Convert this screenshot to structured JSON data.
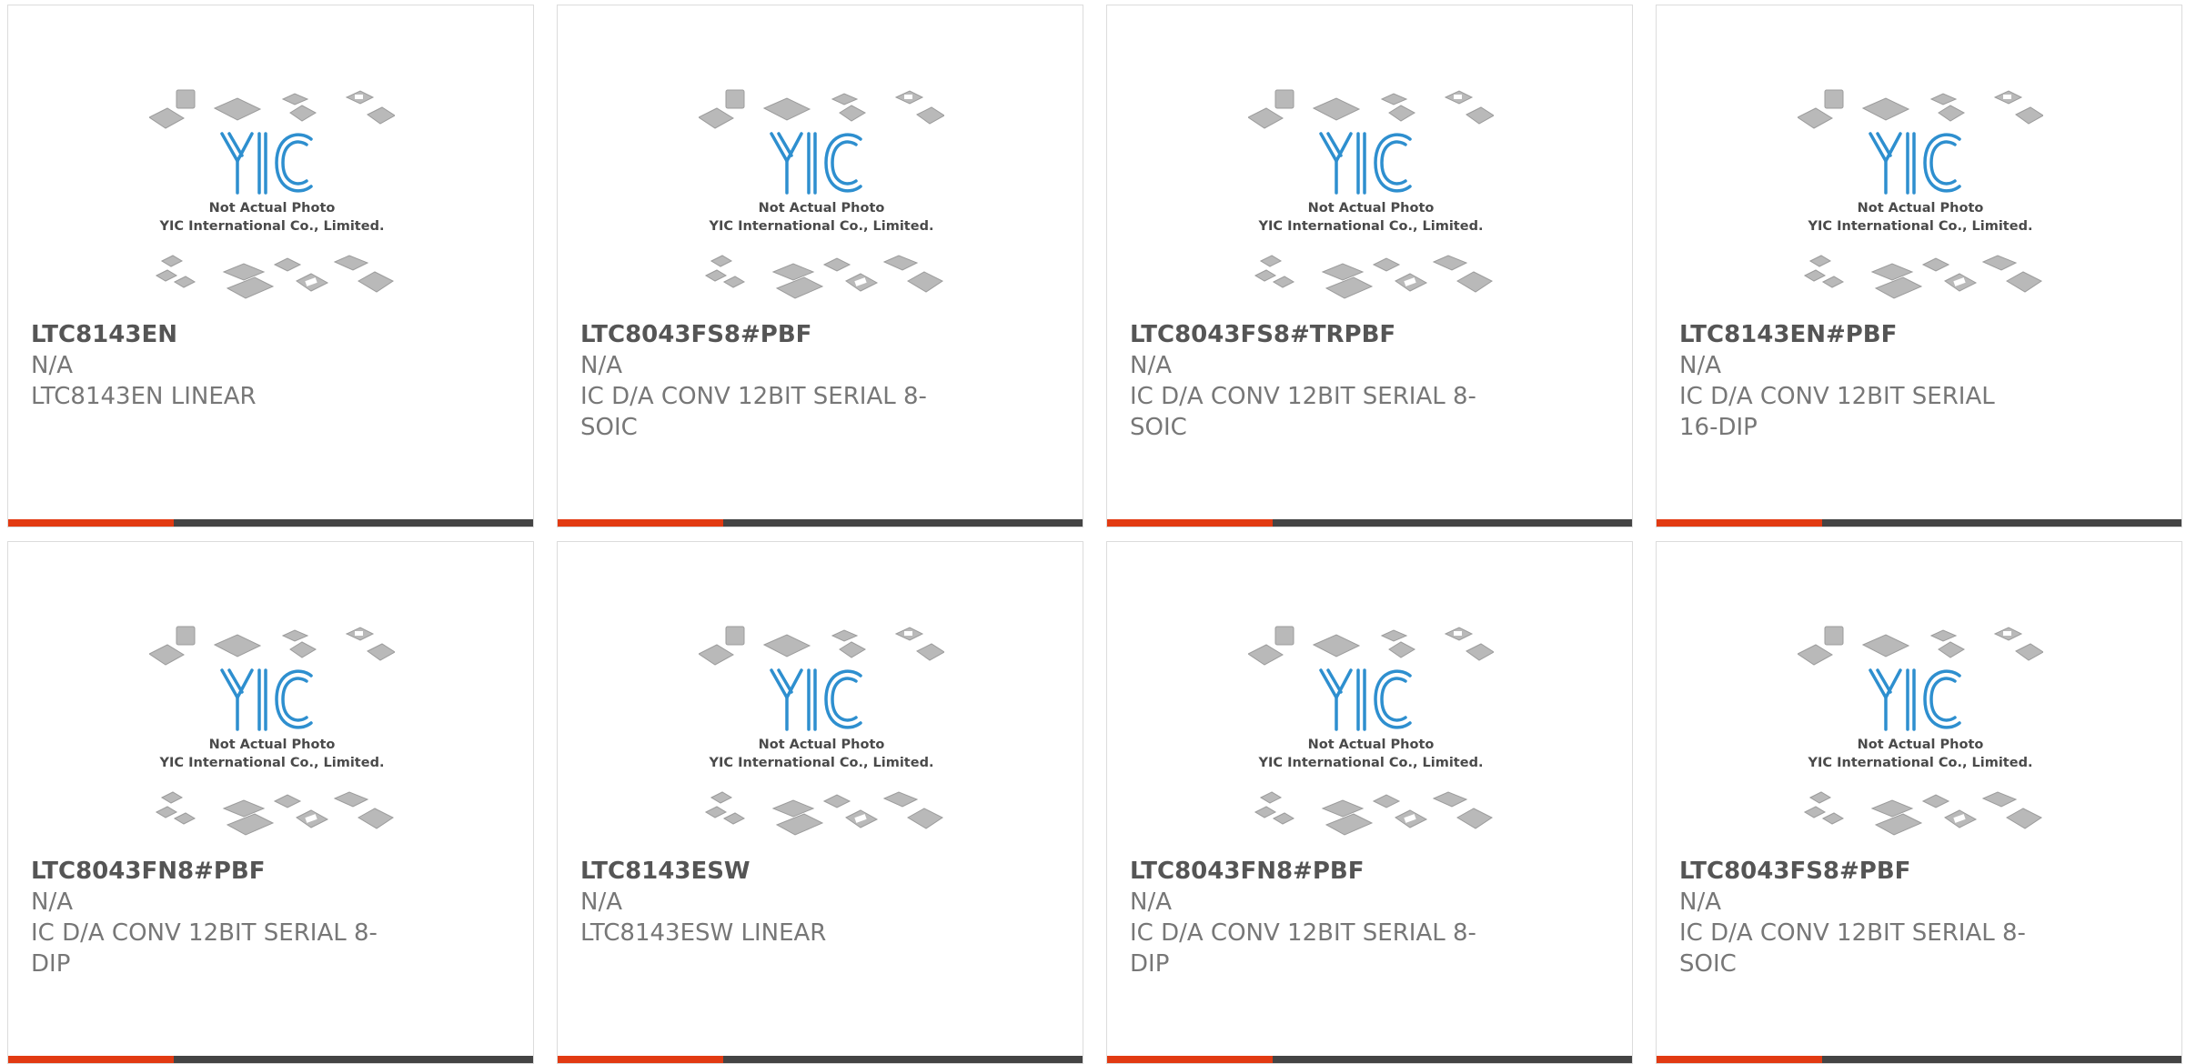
{
  "colors": {
    "accent": "#e23a12",
    "bar": "#444444",
    "logo": "#2e8fcf",
    "part_number": "#555555",
    "text": "#777777"
  },
  "placeholder": {
    "logo_text": "YIC",
    "caption_line1": "Not Actual Photo",
    "caption_line2": "YIC International Co., Limited."
  },
  "products": [
    {
      "part_number": "LTC8143EN",
      "manufacturer": "N/A",
      "description": "LTC8143EN LINEAR"
    },
    {
      "part_number": "LTC8043FS8#PBF",
      "manufacturer": "N/A",
      "description": "IC D/A CONV 12BIT SERIAL 8-SOIC"
    },
    {
      "part_number": "LTC8043FS8#TRPBF",
      "manufacturer": "N/A",
      "description": "IC D/A CONV 12BIT SERIAL 8-SOIC"
    },
    {
      "part_number": "LTC8143EN#PBF",
      "manufacturer": "N/A",
      "description": "IC D/A CONV 12BIT SERIAL 16-DIP"
    },
    {
      "part_number": "LTC8043FN8#PBF",
      "manufacturer": "N/A",
      "description": "IC D/A CONV 12BIT SERIAL 8-DIP"
    },
    {
      "part_number": "LTC8143ESW",
      "manufacturer": "N/A",
      "description": "LTC8143ESW LINEAR"
    },
    {
      "part_number": "LTC8043FN8#PBF",
      "manufacturer": "N/A",
      "description": "IC D/A CONV 12BIT SERIAL 8-DIP"
    },
    {
      "part_number": "LTC8043FS8#PBF",
      "manufacturer": "N/A",
      "description": "IC D/A CONV 12BIT SERIAL 8-SOIC"
    }
  ]
}
